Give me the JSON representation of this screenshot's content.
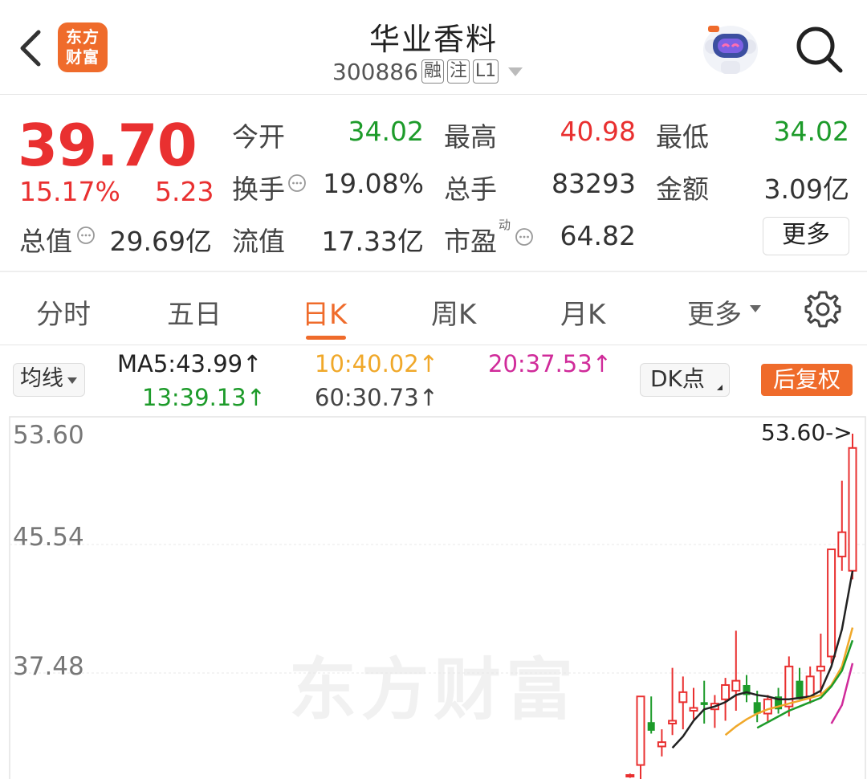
{
  "header": {
    "logo_line1": "东方",
    "logo_line2": "财富",
    "title": "华业香料",
    "code": "300886",
    "tags": [
      "融",
      "注",
      "L1"
    ]
  },
  "quote": {
    "price": "39.70",
    "change_pct": "15.17%",
    "change_amt": "5.23",
    "fields": {
      "open": {
        "label": "今开",
        "value": "34.02"
      },
      "high": {
        "label": "最高",
        "value": "40.98"
      },
      "low": {
        "label": "最低",
        "value": "34.02"
      },
      "turnover": {
        "label": "换手",
        "value": "19.08%"
      },
      "volume": {
        "label": "总手",
        "value": "83293"
      },
      "amount": {
        "label": "金额",
        "value": "3.09亿"
      },
      "total_mv": {
        "label": "总值",
        "value": "29.69亿"
      },
      "float_mv": {
        "label": "流值",
        "value": "17.33亿"
      },
      "pe": {
        "label": "市盈",
        "sup": "动",
        "value": "64.82"
      }
    },
    "more_label": "更多",
    "colors": {
      "up": "#e93030",
      "down": "#1d9b2a"
    }
  },
  "tabs": {
    "items": [
      "分时",
      "五日",
      "日K",
      "周K",
      "月K",
      "更多"
    ],
    "active": "日K"
  },
  "indicators": {
    "ma_select": "均线",
    "ma5": "MA5:43.99↑",
    "ma10": "10:40.02↑",
    "ma20": "20:37.53↑",
    "ma30": "13:39.13↑",
    "ma60": "60:30.73↑",
    "dk_label": "DK点",
    "adjust_label": "后复权"
  },
  "chart": {
    "watermark": "东方财富",
    "y_labels": [
      "53.60",
      "45.54",
      "37.48"
    ],
    "max_annotation": "53.60->",
    "colors": {
      "up": "#e93030",
      "down": "#1d9b2a",
      "ma5": "#222222",
      "ma10": "#f0a82a",
      "ma20": "#d02b9a",
      "ma30": "#1d9b2a"
    }
  },
  "chart_data": {
    "type": "candlestick",
    "ylim": [
      29.42,
      53.6
    ],
    "y_ticks": [
      53.6,
      45.54,
      37.48
    ],
    "candles": [
      {
        "o": 29.6,
        "h": 29.8,
        "l": 29.5,
        "c": 29.7
      },
      {
        "o": 30.4,
        "h": 35.2,
        "l": 29.4,
        "c": 35.2
      },
      {
        "o": 33.4,
        "h": 35.2,
        "l": 32.6,
        "c": 32.8
      },
      {
        "o": 31.7,
        "h": 32.9,
        "l": 31.0,
        "c": 32.0
      },
      {
        "o": 33.3,
        "h": 37.2,
        "l": 32.5,
        "c": 33.5
      },
      {
        "o": 34.8,
        "h": 36.6,
        "l": 32.9,
        "c": 35.5
      },
      {
        "o": 34.2,
        "h": 35.8,
        "l": 33.6,
        "c": 34.4
      },
      {
        "o": 34.8,
        "h": 36.3,
        "l": 33.3,
        "c": 34.6
      },
      {
        "o": 34.3,
        "h": 35.3,
        "l": 33.0,
        "c": 34.7
      },
      {
        "o": 35.0,
        "h": 36.5,
        "l": 33.5,
        "c": 36.0
      },
      {
        "o": 35.6,
        "h": 39.8,
        "l": 34.2,
        "c": 36.3
      },
      {
        "o": 36.0,
        "h": 36.7,
        "l": 34.8,
        "c": 35.3
      },
      {
        "o": 34.8,
        "h": 35.6,
        "l": 33.4,
        "c": 34.0
      },
      {
        "o": 34.0,
        "h": 35.3,
        "l": 33.4,
        "c": 35.0
      },
      {
        "o": 35.2,
        "h": 35.8,
        "l": 34.0,
        "c": 34.3
      },
      {
        "o": 34.5,
        "h": 38.0,
        "l": 33.8,
        "c": 37.3
      },
      {
        "o": 36.3,
        "h": 37.2,
        "l": 35.0,
        "c": 35.0
      },
      {
        "o": 35.2,
        "h": 37.3,
        "l": 34.7,
        "c": 36.6
      },
      {
        "o": 37.0,
        "h": 39.6,
        "l": 35.4,
        "c": 37.3
      },
      {
        "o": 38.0,
        "h": 45.5,
        "l": 37.5,
        "c": 45.5
      },
      {
        "o": 45.0,
        "h": 50.3,
        "l": 44.0,
        "c": 46.7
      },
      {
        "o": 44.0,
        "h": 53.6,
        "l": 43.4,
        "c": 52.6
      }
    ],
    "ma_lines": [
      {
        "name": "MA5",
        "values": [
          null,
          null,
          null,
          null,
          31.6,
          32.4,
          33.5,
          34.3,
          34.5,
          34.8,
          35.3,
          35.5,
          35.3,
          35.2,
          35.0,
          35.0,
          35.1,
          35.2,
          35.6,
          37.3,
          39.9,
          43.99
        ]
      },
      {
        "name": "MA10",
        "values": [
          null,
          null,
          null,
          null,
          null,
          null,
          null,
          null,
          null,
          32.5,
          33.1,
          33.6,
          34.0,
          34.3,
          34.5,
          34.7,
          34.9,
          35.1,
          35.3,
          36.0,
          37.3,
          40.02
        ]
      },
      {
        "name": "MA20",
        "values": [
          null,
          null,
          null,
          null,
          null,
          null,
          null,
          null,
          null,
          null,
          null,
          null,
          null,
          null,
          null,
          null,
          null,
          null,
          null,
          33.3,
          34.6,
          37.53
        ]
      },
      {
        "name": "MA13",
        "values": [
          null,
          null,
          null,
          null,
          null,
          null,
          null,
          null,
          null,
          null,
          null,
          null,
          33.0,
          33.4,
          33.8,
          34.2,
          34.5,
          34.8,
          35.1,
          35.9,
          37.0,
          39.13
        ]
      }
    ]
  }
}
